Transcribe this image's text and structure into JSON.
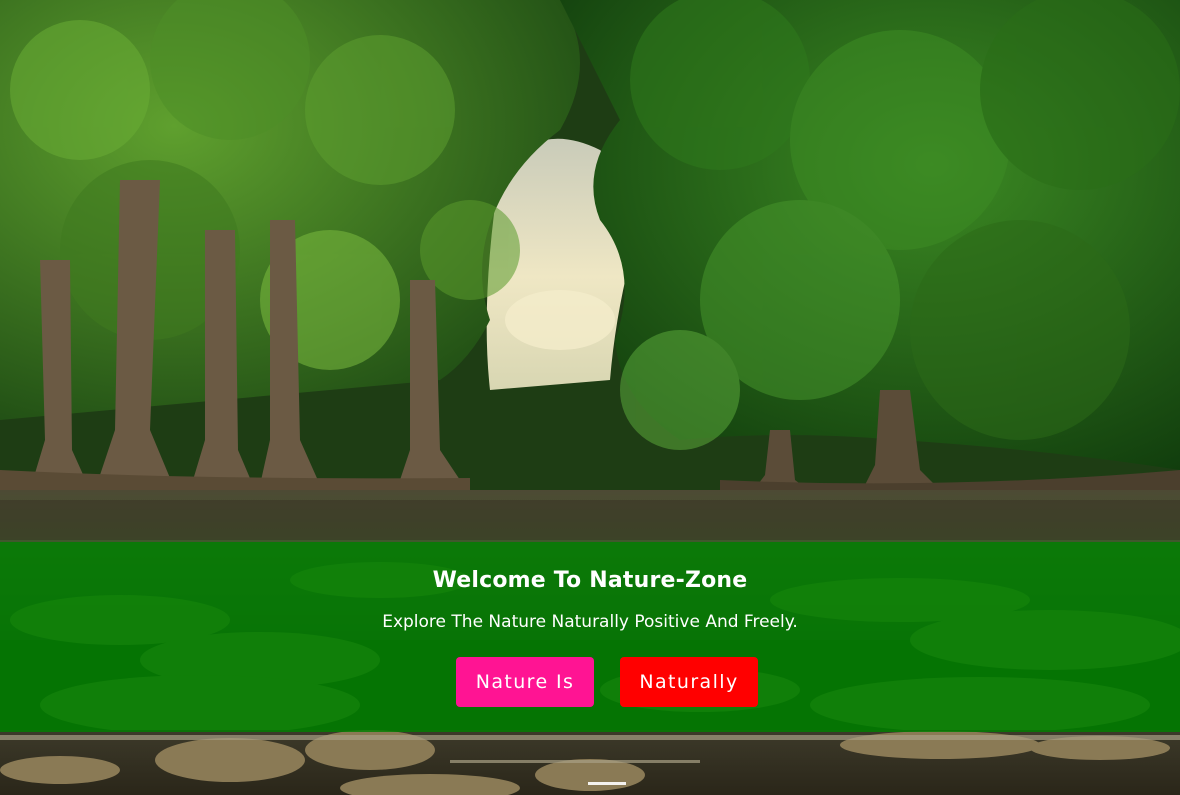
{
  "hero": {
    "title": "Welcome To Nature-Zone",
    "subtitle": "Explore The Nature Naturally Positive And Freely.",
    "buttons": [
      {
        "label": "Nature Is",
        "color": "#ff1493"
      },
      {
        "label": "Naturally",
        "color": "#ff0000"
      }
    ],
    "overlay_color": "#008000",
    "background_image": "forest-river-scene"
  },
  "carousel": {
    "indicators": 1,
    "active_index": 0
  }
}
